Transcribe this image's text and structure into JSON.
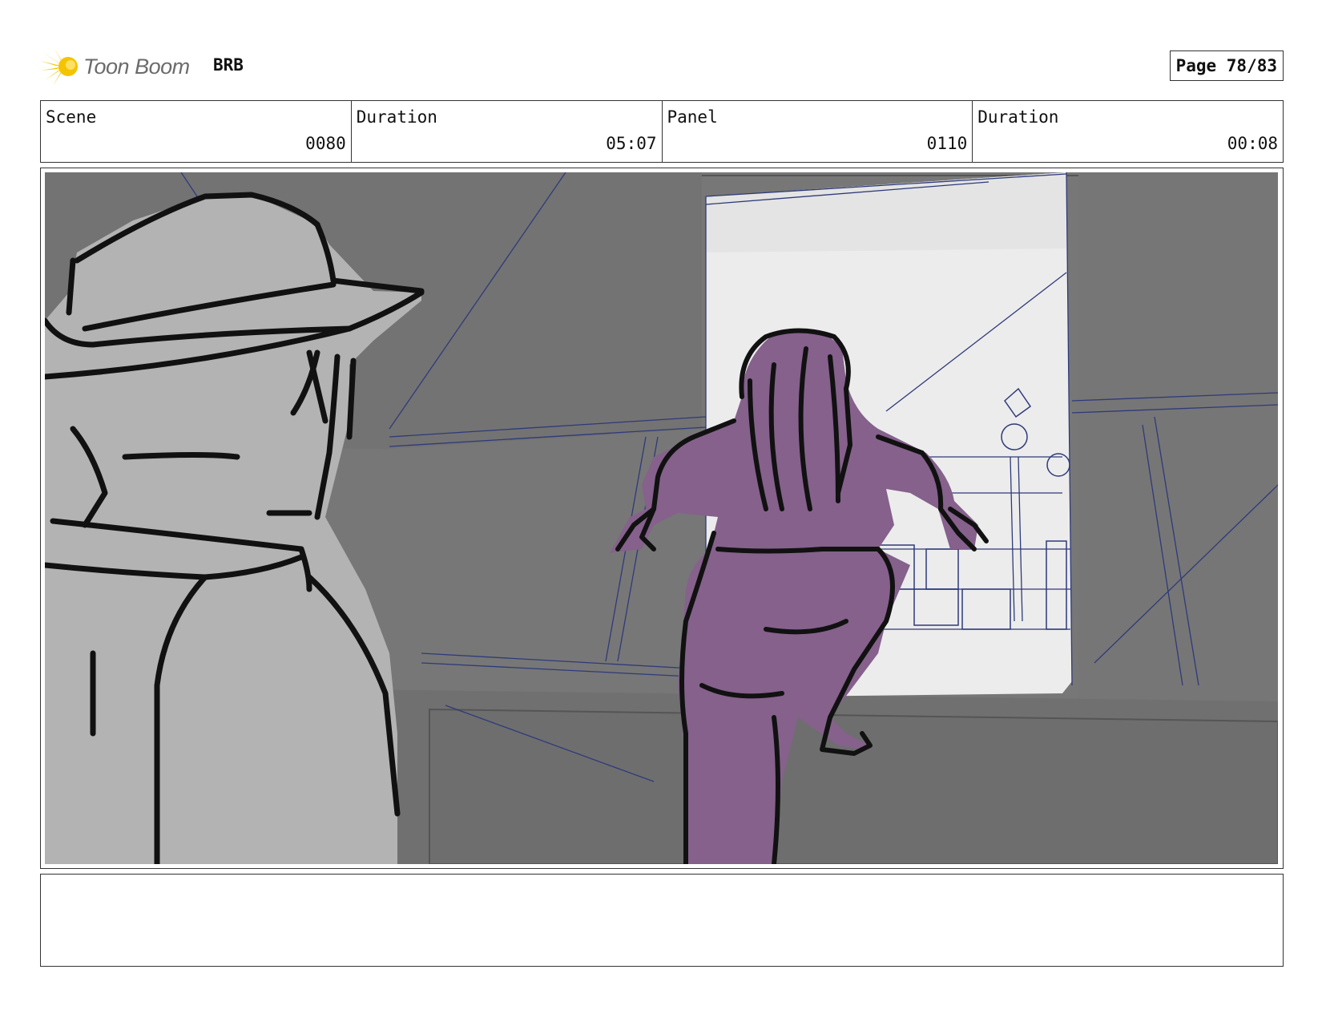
{
  "header": {
    "logo_text": "Toon Boom",
    "project": "BRB",
    "page_label": "Page 78/83"
  },
  "info": {
    "scene_label": "Scene",
    "scene_value": "0080",
    "scene_duration_label": "Duration",
    "scene_duration_value": "05:07",
    "panel_label": "Panel",
    "panel_value": "0110",
    "panel_duration_label": "Duration",
    "panel_duration_value": "00:08"
  },
  "notes": {
    "text": ""
  },
  "colors": {
    "logo_yellow": "#f5c400",
    "character_purple": "#85618c",
    "foreground_gray": "#b3b3b3",
    "background_gray": "#777777",
    "doorway_light": "#ececec",
    "construction_lines": "#2f3a7a"
  }
}
